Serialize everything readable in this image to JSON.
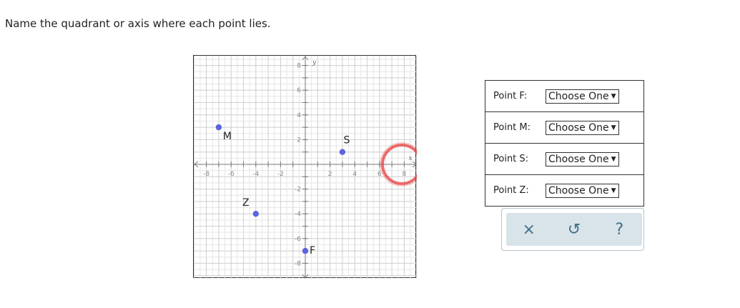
{
  "instruction": "Name the quadrant or axis where each point lies.",
  "graph": {
    "axis_x_label": "x",
    "axis_y_label": "y",
    "x_tick_labels": [
      "-8",
      "-6",
      "-4",
      "-2",
      "2",
      "4",
      "6",
      "8"
    ],
    "y_tick_labels": [
      "8",
      "6",
      "4",
      "2",
      "-2",
      "-4",
      "-6",
      "-8"
    ],
    "points": [
      {
        "label": "M",
        "x": -7,
        "y": 3
      },
      {
        "label": "S",
        "x": 3,
        "y": 1
      },
      {
        "label": "Z",
        "x": -4,
        "y": -4
      },
      {
        "label": "F",
        "x": 0,
        "y": -7
      }
    ],
    "point_color": "#5b63e0",
    "highlight_color": "#e53b3b"
  },
  "answers": [
    {
      "label": "Point F:",
      "selected": "Choose One"
    },
    {
      "label": "Point M:",
      "selected": "Choose One"
    },
    {
      "label": "Point S:",
      "selected": "Choose One"
    },
    {
      "label": "Point Z:",
      "selected": "Choose One"
    }
  ],
  "toolbar": {
    "clear_glyph": "×",
    "undo_glyph": "↺",
    "help_glyph": "?"
  }
}
